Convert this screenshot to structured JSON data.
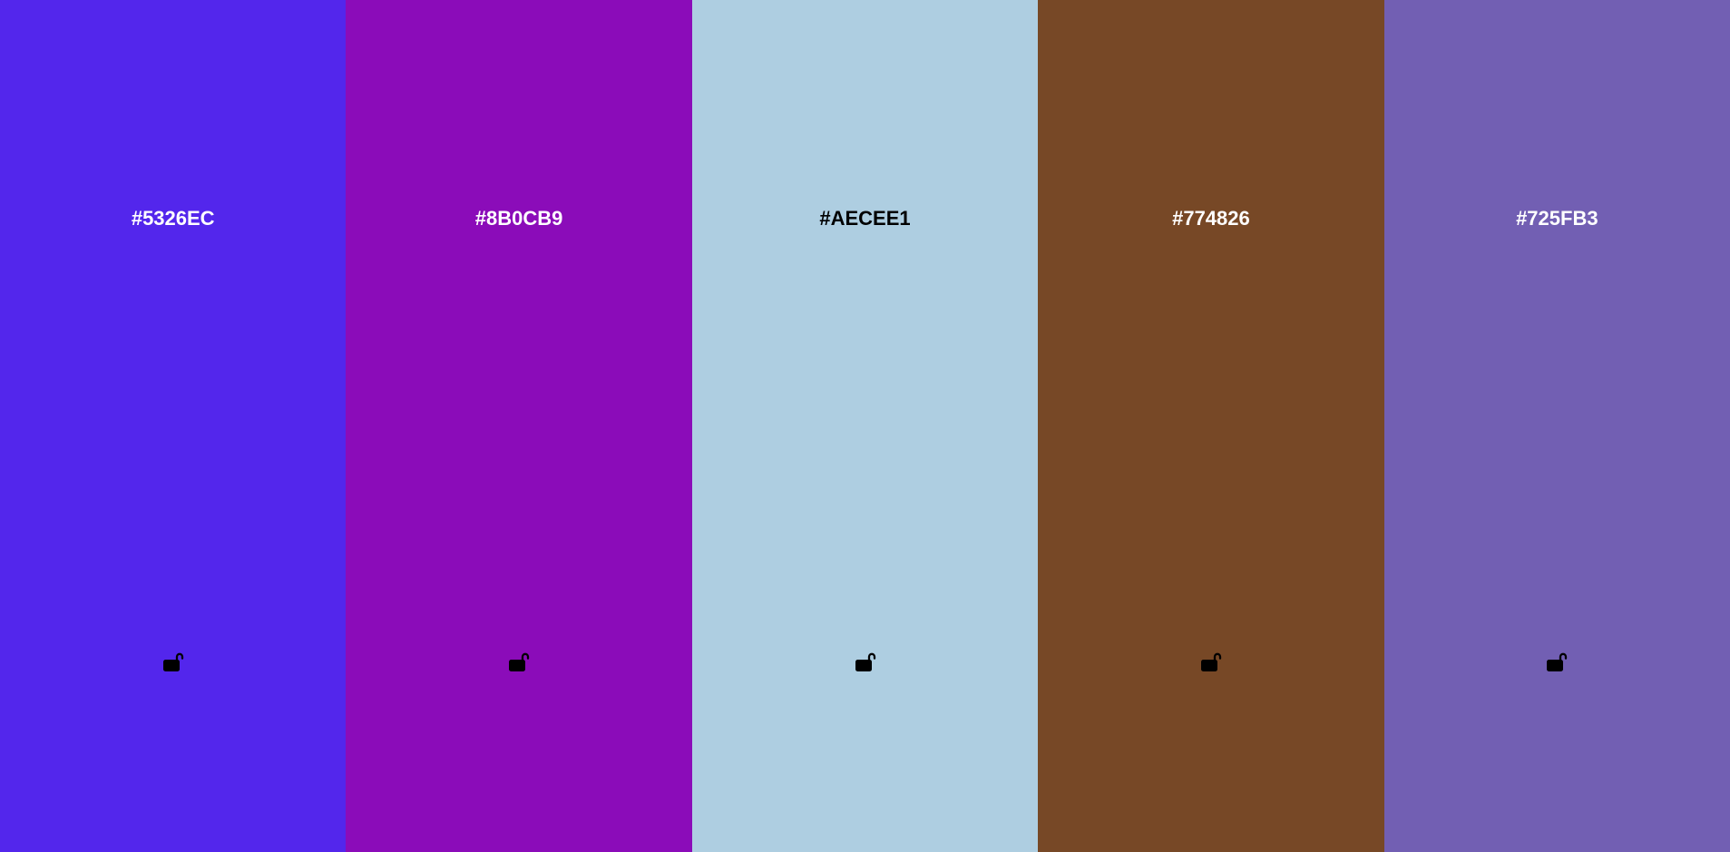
{
  "palette": {
    "colors": [
      {
        "hex": "#5326EC",
        "text_color": "#FFFFFF",
        "locked": false,
        "lock_icon": "unlock-icon"
      },
      {
        "hex": "#8B0CB9",
        "text_color": "#FFFFFF",
        "locked": false,
        "lock_icon": "unlock-icon"
      },
      {
        "hex": "#AECEE1",
        "text_color": "#000000",
        "locked": false,
        "lock_icon": "unlock-icon"
      },
      {
        "hex": "#774826",
        "text_color": "#FFFFFF",
        "locked": false,
        "lock_icon": "unlock-icon"
      },
      {
        "hex": "#725FB3",
        "text_color": "#FFFFFF",
        "locked": false,
        "lock_icon": "unlock-icon"
      }
    ]
  }
}
